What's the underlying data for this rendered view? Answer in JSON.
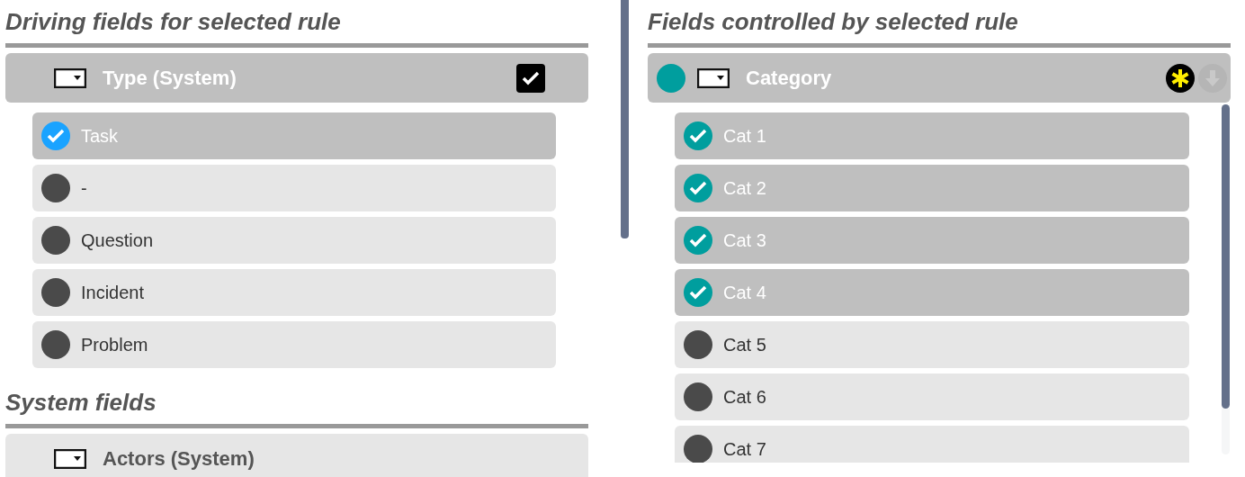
{
  "driving_fields": {
    "heading": "Driving fields for selected rule",
    "field": {
      "label": "Type (System)",
      "selected": true,
      "checked": true
    },
    "options": [
      {
        "label": "Task",
        "selected": true
      },
      {
        "label": "-",
        "selected": false
      },
      {
        "label": "Question",
        "selected": false
      },
      {
        "label": "Incident",
        "selected": false
      },
      {
        "label": "Problem",
        "selected": false
      }
    ]
  },
  "system_fields": {
    "heading": "System fields",
    "fields": [
      {
        "label": "Actors (System)",
        "selected": false
      }
    ]
  },
  "controlled_fields": {
    "heading": "Fields controlled by selected rule",
    "field": {
      "label": "Category",
      "selected": true
    },
    "options": [
      {
        "label": "Cat 1",
        "selected": true
      },
      {
        "label": "Cat 2",
        "selected": true
      },
      {
        "label": "Cat 3",
        "selected": true
      },
      {
        "label": "Cat 4",
        "selected": true
      },
      {
        "label": "Cat 5",
        "selected": false
      },
      {
        "label": "Cat 6",
        "selected": false
      },
      {
        "label": "Cat 7",
        "selected": false
      }
    ]
  }
}
